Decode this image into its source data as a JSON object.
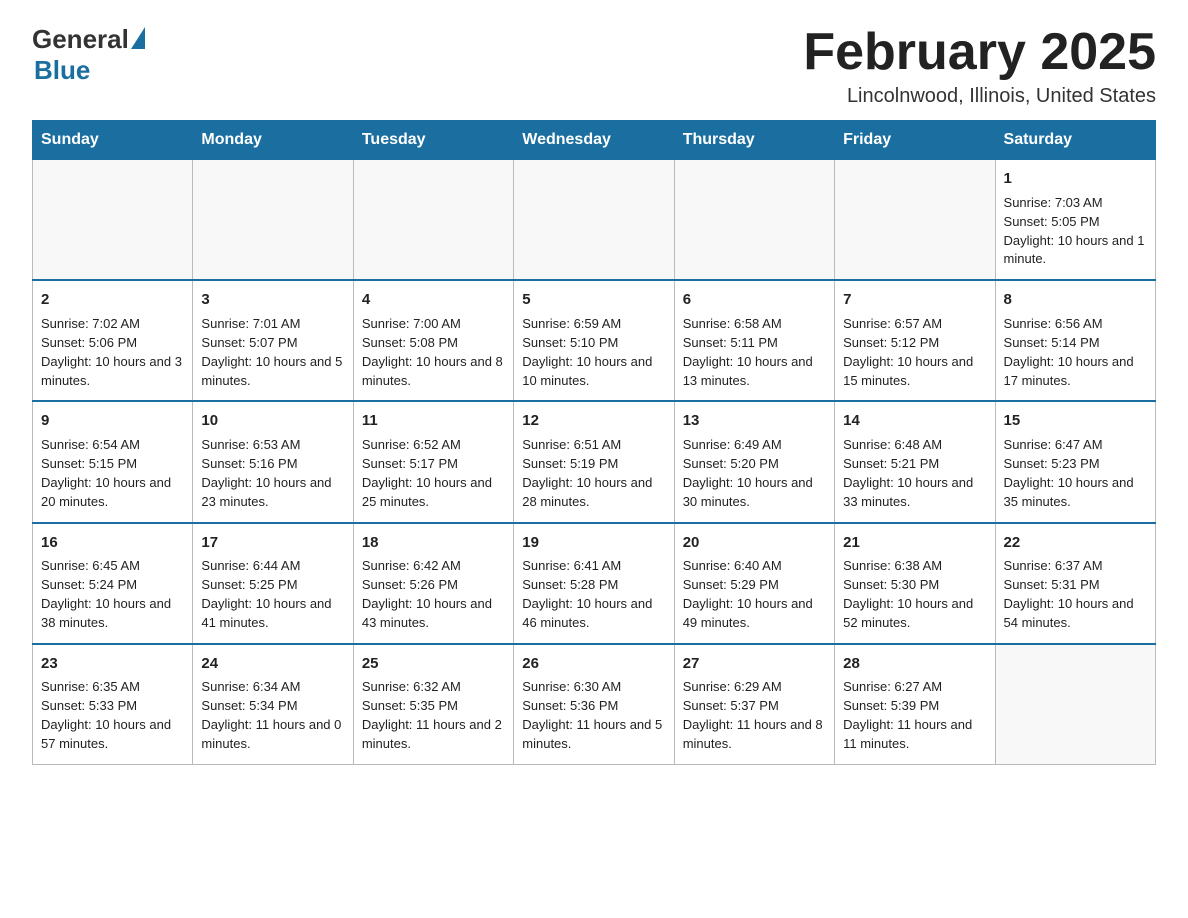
{
  "logo": {
    "general": "General",
    "blue": "Blue"
  },
  "title": "February 2025",
  "location": "Lincolnwood, Illinois, United States",
  "days_of_week": [
    "Sunday",
    "Monday",
    "Tuesday",
    "Wednesday",
    "Thursday",
    "Friday",
    "Saturday"
  ],
  "weeks": [
    [
      {
        "day": "",
        "info": ""
      },
      {
        "day": "",
        "info": ""
      },
      {
        "day": "",
        "info": ""
      },
      {
        "day": "",
        "info": ""
      },
      {
        "day": "",
        "info": ""
      },
      {
        "day": "",
        "info": ""
      },
      {
        "day": "1",
        "info": "Sunrise: 7:03 AM\nSunset: 5:05 PM\nDaylight: 10 hours and 1 minute."
      }
    ],
    [
      {
        "day": "2",
        "info": "Sunrise: 7:02 AM\nSunset: 5:06 PM\nDaylight: 10 hours and 3 minutes."
      },
      {
        "day": "3",
        "info": "Sunrise: 7:01 AM\nSunset: 5:07 PM\nDaylight: 10 hours and 5 minutes."
      },
      {
        "day": "4",
        "info": "Sunrise: 7:00 AM\nSunset: 5:08 PM\nDaylight: 10 hours and 8 minutes."
      },
      {
        "day": "5",
        "info": "Sunrise: 6:59 AM\nSunset: 5:10 PM\nDaylight: 10 hours and 10 minutes."
      },
      {
        "day": "6",
        "info": "Sunrise: 6:58 AM\nSunset: 5:11 PM\nDaylight: 10 hours and 13 minutes."
      },
      {
        "day": "7",
        "info": "Sunrise: 6:57 AM\nSunset: 5:12 PM\nDaylight: 10 hours and 15 minutes."
      },
      {
        "day": "8",
        "info": "Sunrise: 6:56 AM\nSunset: 5:14 PM\nDaylight: 10 hours and 17 minutes."
      }
    ],
    [
      {
        "day": "9",
        "info": "Sunrise: 6:54 AM\nSunset: 5:15 PM\nDaylight: 10 hours and 20 minutes."
      },
      {
        "day": "10",
        "info": "Sunrise: 6:53 AM\nSunset: 5:16 PM\nDaylight: 10 hours and 23 minutes."
      },
      {
        "day": "11",
        "info": "Sunrise: 6:52 AM\nSunset: 5:17 PM\nDaylight: 10 hours and 25 minutes."
      },
      {
        "day": "12",
        "info": "Sunrise: 6:51 AM\nSunset: 5:19 PM\nDaylight: 10 hours and 28 minutes."
      },
      {
        "day": "13",
        "info": "Sunrise: 6:49 AM\nSunset: 5:20 PM\nDaylight: 10 hours and 30 minutes."
      },
      {
        "day": "14",
        "info": "Sunrise: 6:48 AM\nSunset: 5:21 PM\nDaylight: 10 hours and 33 minutes."
      },
      {
        "day": "15",
        "info": "Sunrise: 6:47 AM\nSunset: 5:23 PM\nDaylight: 10 hours and 35 minutes."
      }
    ],
    [
      {
        "day": "16",
        "info": "Sunrise: 6:45 AM\nSunset: 5:24 PM\nDaylight: 10 hours and 38 minutes."
      },
      {
        "day": "17",
        "info": "Sunrise: 6:44 AM\nSunset: 5:25 PM\nDaylight: 10 hours and 41 minutes."
      },
      {
        "day": "18",
        "info": "Sunrise: 6:42 AM\nSunset: 5:26 PM\nDaylight: 10 hours and 43 minutes."
      },
      {
        "day": "19",
        "info": "Sunrise: 6:41 AM\nSunset: 5:28 PM\nDaylight: 10 hours and 46 minutes."
      },
      {
        "day": "20",
        "info": "Sunrise: 6:40 AM\nSunset: 5:29 PM\nDaylight: 10 hours and 49 minutes."
      },
      {
        "day": "21",
        "info": "Sunrise: 6:38 AM\nSunset: 5:30 PM\nDaylight: 10 hours and 52 minutes."
      },
      {
        "day": "22",
        "info": "Sunrise: 6:37 AM\nSunset: 5:31 PM\nDaylight: 10 hours and 54 minutes."
      }
    ],
    [
      {
        "day": "23",
        "info": "Sunrise: 6:35 AM\nSunset: 5:33 PM\nDaylight: 10 hours and 57 minutes."
      },
      {
        "day": "24",
        "info": "Sunrise: 6:34 AM\nSunset: 5:34 PM\nDaylight: 11 hours and 0 minutes."
      },
      {
        "day": "25",
        "info": "Sunrise: 6:32 AM\nSunset: 5:35 PM\nDaylight: 11 hours and 2 minutes."
      },
      {
        "day": "26",
        "info": "Sunrise: 6:30 AM\nSunset: 5:36 PM\nDaylight: 11 hours and 5 minutes."
      },
      {
        "day": "27",
        "info": "Sunrise: 6:29 AM\nSunset: 5:37 PM\nDaylight: 11 hours and 8 minutes."
      },
      {
        "day": "28",
        "info": "Sunrise: 6:27 AM\nSunset: 5:39 PM\nDaylight: 11 hours and 11 minutes."
      },
      {
        "day": "",
        "info": ""
      }
    ]
  ]
}
